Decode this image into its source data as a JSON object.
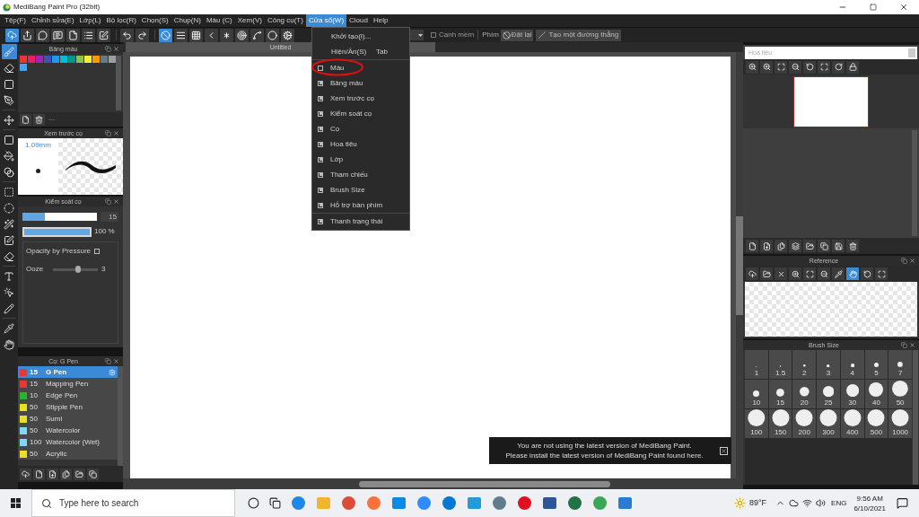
{
  "window": {
    "title": "MediBang Paint Pro (32bit)"
  },
  "menu_bar": [
    {
      "label": "Tệp(F)",
      "selected": false
    },
    {
      "label": "Chỉnh sửa(E)",
      "selected": false
    },
    {
      "label": "Lớp(L)",
      "selected": false
    },
    {
      "label": "Bộ lọc(R)",
      "selected": false
    },
    {
      "label": "Chọn(S)",
      "selected": false
    },
    {
      "label": "Chụp(N)",
      "selected": false
    },
    {
      "label": "Màu (C)",
      "selected": false
    },
    {
      "label": "Xem(V)",
      "selected": false
    },
    {
      "label": "Công cụ(T)",
      "selected": false
    },
    {
      "label": "Cửa sổ(W)",
      "selected": true
    },
    {
      "label": "Cloud",
      "selected": false
    },
    {
      "label": "Help",
      "selected": false
    }
  ],
  "toolbar": {
    "soft_edge": {
      "label": "Cạnh mềm",
      "checked": false
    },
    "keys_label": "Phím",
    "reset_button": "Đặt lại",
    "line_button": "Tạo một đường thẳng"
  },
  "window_menu": {
    "sections": [
      [
        {
          "kind": "command",
          "label": "Khởi tạo(I)..."
        },
        {
          "kind": "command",
          "label": "Hiện/Ẩn(S)",
          "shortcut": "Tab"
        }
      ],
      [
        {
          "kind": "toggle",
          "label": "Màu",
          "checked": false,
          "circled": true
        },
        {
          "kind": "toggle",
          "label": "Bảng màu",
          "checked": true,
          "circled": false
        },
        {
          "kind": "toggle",
          "label": "Xem trước cọ",
          "checked": true,
          "circled": false
        },
        {
          "kind": "toggle",
          "label": "Kiểm soát cọ",
          "checked": true,
          "circled": false
        },
        {
          "kind": "toggle",
          "label": "Cọ",
          "checked": true,
          "circled": false
        },
        {
          "kind": "toggle",
          "label": "Hoa tiêu",
          "checked": true,
          "circled": false
        },
        {
          "kind": "toggle",
          "label": "Lớp",
          "checked": true,
          "circled": false
        },
        {
          "kind": "toggle",
          "label": "Tham chiếu",
          "checked": true,
          "circled": false
        },
        {
          "kind": "toggle",
          "label": "Brush Size",
          "checked": true,
          "circled": false
        },
        {
          "kind": "toggle",
          "label": "Hỗ trợ bàn phím",
          "checked": true,
          "circled": false
        }
      ],
      [
        {
          "kind": "toggle",
          "label": "Thanh trạng thái",
          "checked": true,
          "circled": false
        }
      ]
    ]
  },
  "canvas": {
    "tab": "Untitled"
  },
  "color_palette": {
    "title": "Bảng màu",
    "swatches": [
      {
        "color": "#e53935"
      },
      {
        "color": "#e91e63"
      },
      {
        "color": "#9c27b0"
      },
      {
        "color": "#3f51b5"
      },
      {
        "color": "#2196f3"
      },
      {
        "color": "#00bcd4"
      },
      {
        "color": "#009688"
      },
      {
        "color": "#8bc34a"
      },
      {
        "color": "#ffeb3b"
      },
      {
        "color": "#ff9800"
      },
      {
        "color": "#607d8b"
      },
      {
        "color": "#9e9e9e"
      },
      {
        "color": "#42a5f5"
      }
    ],
    "footer": "---"
  },
  "brush_preview": {
    "title": "Xem trước cọ",
    "size": "1.09mm"
  },
  "brush_control": {
    "title": "Kiểm soát cọ",
    "size": {
      "level": 0.3,
      "value": "15"
    },
    "opacity": {
      "level": 1,
      "value": "100 %"
    },
    "opacity_by_pressure": {
      "label": "Opacity by Pressure",
      "checked": false
    },
    "ooze": {
      "label": "Ooze",
      "level": 0.55,
      "value": "3"
    }
  },
  "brushes": {
    "title": "Cọ: G Pen",
    "items": [
      {
        "size": "15",
        "name": "G Pen",
        "color": "#e53935",
        "selected": true
      },
      {
        "size": "15",
        "name": "Mapping Pen",
        "color": "#e53935",
        "selected": false
      },
      {
        "size": "10",
        "name": "Edge Pen",
        "color": "#2bb32b",
        "selected": false
      },
      {
        "size": "50",
        "name": "Stipple Pen",
        "color": "#e8e020",
        "selected": false
      },
      {
        "size": "50",
        "name": "Sumi",
        "color": "#e8e020",
        "selected": false
      },
      {
        "size": "50",
        "name": "Watercolor",
        "color": "#7fd8f5",
        "selected": false
      },
      {
        "size": "100",
        "name": "Watercolor (Wet)",
        "color": "#7fd8f5",
        "selected": false
      },
      {
        "size": "50",
        "name": "Acrylic",
        "color": "#e8e020",
        "selected": false
      }
    ]
  },
  "navigator": {
    "title": "Hoa tiêu"
  },
  "reference": {
    "title": "Reference"
  },
  "brush_size": {
    "title": "Brush Size",
    "options": [
      "1",
      "1.5",
      "2",
      "3",
      "4",
      "5",
      "7",
      "10",
      "15",
      "20",
      "25",
      "30",
      "40",
      "50",
      "100",
      "150",
      "200",
      "300",
      "400",
      "500",
      "1000"
    ]
  },
  "notification": {
    "lines": [
      "You are not using the latest version of MediBang Paint.",
      "Please install the latest version of MediBang Paint found here."
    ]
  },
  "taskbar": {
    "search_placeholder": "Type here to search",
    "weather": "89°F",
    "language": "ENG",
    "time": "9:56 AM",
    "date": "6/10/2021"
  }
}
